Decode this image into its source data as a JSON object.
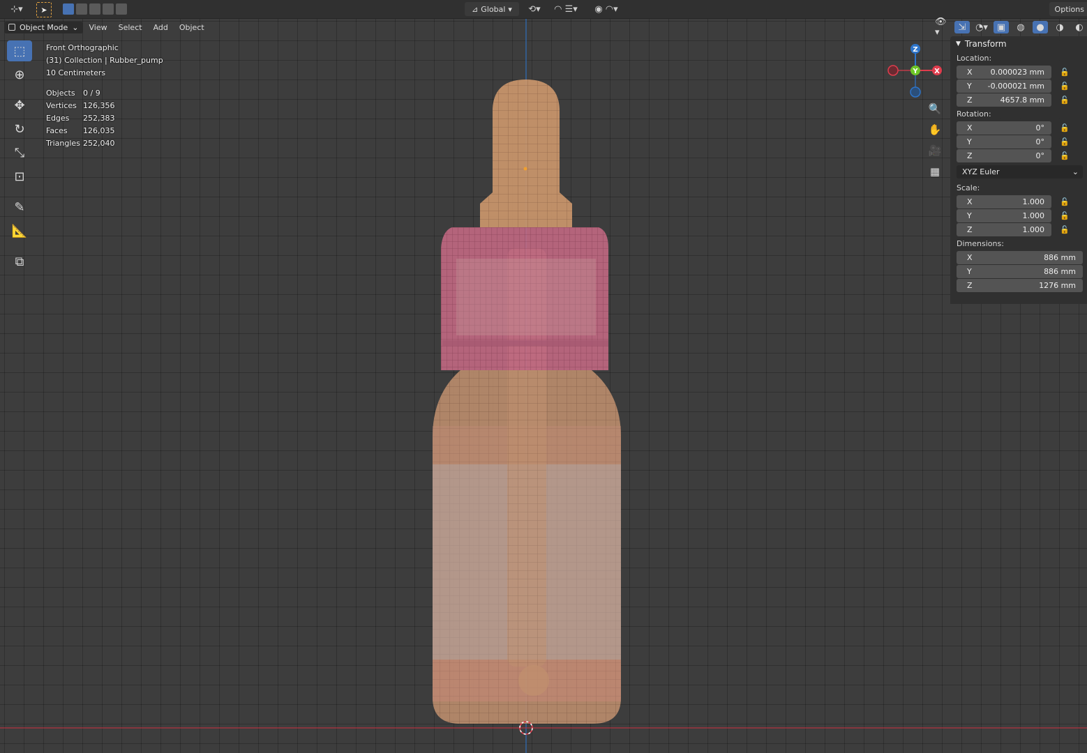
{
  "header": {
    "mode_label": "Object Mode",
    "menus": [
      "View",
      "Select",
      "Add",
      "Object"
    ],
    "orientation_label": "Global",
    "options_label": "Options"
  },
  "overlay": {
    "view_name": "Front Orthographic",
    "collection": "(31) Collection | Rubber_pump",
    "scale": "10 Centimeters",
    "stats": [
      {
        "label": "Objects",
        "value": "0 / 9"
      },
      {
        "label": "Vertices",
        "value": "126,356"
      },
      {
        "label": "Edges",
        "value": "252,383"
      },
      {
        "label": "Faces",
        "value": "126,035"
      },
      {
        "label": "Triangles",
        "value": "252,040"
      }
    ]
  },
  "gizmo": {
    "z": "Z",
    "y": "Y",
    "x": "X"
  },
  "npanel": {
    "title": "Transform",
    "location_label": "Location:",
    "location": [
      {
        "axis": "X",
        "value": "0.000023 mm"
      },
      {
        "axis": "Y",
        "value": "-0.000021 mm"
      },
      {
        "axis": "Z",
        "value": "4657.8 mm"
      }
    ],
    "rotation_label": "Rotation:",
    "rotation": [
      {
        "axis": "X",
        "value": "0°"
      },
      {
        "axis": "Y",
        "value": "0°"
      },
      {
        "axis": "Z",
        "value": "0°"
      }
    ],
    "rotation_mode": "XYZ Euler",
    "scale_label": "Scale:",
    "scale": [
      {
        "axis": "X",
        "value": "1.000"
      },
      {
        "axis": "Y",
        "value": "1.000"
      },
      {
        "axis": "Z",
        "value": "1.000"
      }
    ],
    "dimensions_label": "Dimensions:",
    "dimensions": [
      {
        "axis": "X",
        "value": "886 mm"
      },
      {
        "axis": "Y",
        "value": "886 mm"
      },
      {
        "axis": "Z",
        "value": "1276 mm"
      }
    ]
  },
  "colors": {
    "active_tool": "#4772b3",
    "axis_x": "#e03c4d",
    "axis_y": "#6ec627",
    "axis_z": "#2d74c9",
    "bottle": "#c8926a",
    "cap": "#c06a86"
  }
}
